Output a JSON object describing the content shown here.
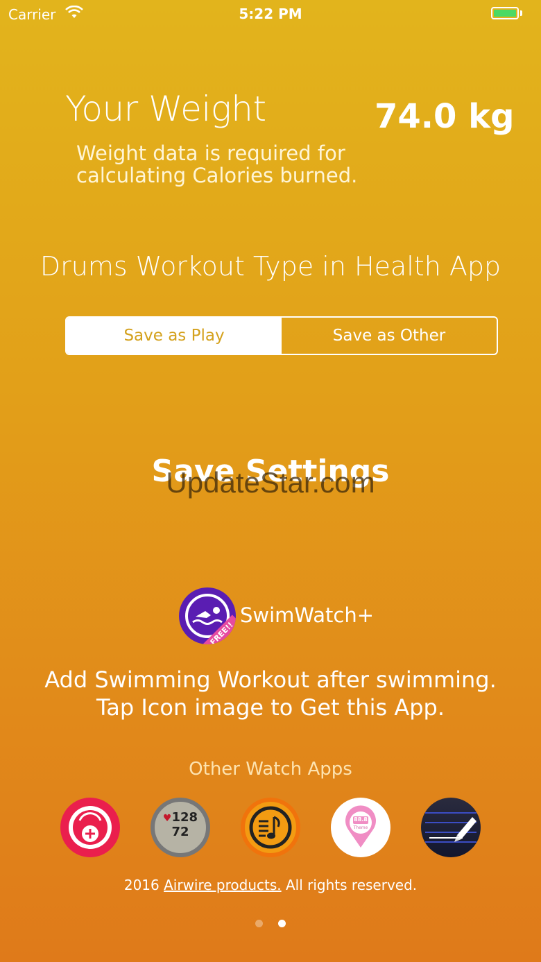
{
  "status_bar": {
    "carrier": "Carrier",
    "time": "5:22 PM",
    "icons": [
      "wifi-icon",
      "battery-icon"
    ],
    "battery_color": "#4cd964"
  },
  "weight": {
    "title": "Your Weight",
    "value": "74.0 kg",
    "note_line1": "Weight data is required for",
    "note_line2": "calculating Calories burned."
  },
  "workout_type": {
    "title": "Drums Workout Type in Health App",
    "options": [
      "Save as Play",
      "Save as Other"
    ],
    "selected": "Save as Play"
  },
  "save_button_label": "Save Settings",
  "watermark": "UpdateStar.com",
  "promo": {
    "app_name": "SwimWatch+",
    "badge": "FREE!!",
    "line1": "Add Swimming Workout after swimming.",
    "line2": "Tap Icon image to Get this App."
  },
  "other_apps": {
    "title": "Other Watch Apps",
    "icons": [
      "weight-scale-icon",
      "blood-pressure-icon",
      "music-score-icon",
      "pink-pin-icon",
      "pencil-note-icon"
    ],
    "bp_top": "128",
    "bp_bottom": "72",
    "pin_display": "88.8",
    "pin_label": "Theme"
  },
  "footer": {
    "prefix": "2016 ",
    "link": "Airwire products.",
    "suffix": " All rights reserved."
  },
  "pager": {
    "count": 2,
    "current": 2
  },
  "colors": {
    "accent": "#d4a11c",
    "bg_top": "#e2b41c",
    "bg_bottom": "#df7a1a",
    "swim_purple": "#5a1db2"
  }
}
